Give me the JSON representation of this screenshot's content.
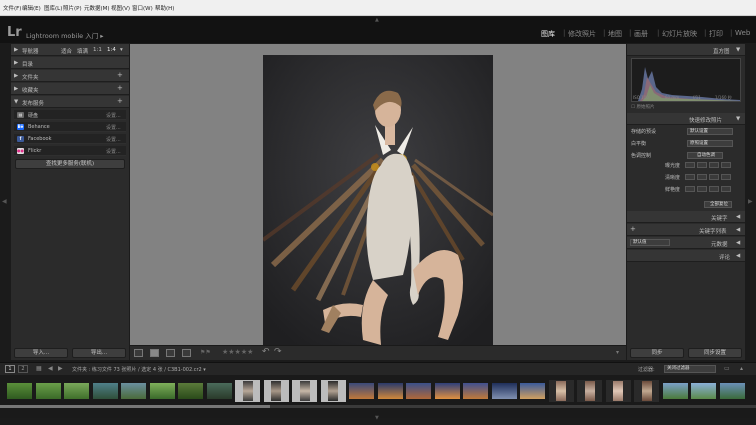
{
  "menubar": {
    "items": [
      "文件(F)",
      "编辑(E)",
      "图库(L)",
      "照片(P)",
      "元数据(M)",
      "视图(V)",
      "窗口(W)",
      "帮助(H)"
    ]
  },
  "identity": {
    "logo": "Lr",
    "app_name": "Lightroom mobile 入门",
    "app_name_arrow": "▸"
  },
  "modules": {
    "items": [
      "图库",
      "修改照片",
      "地图",
      "画册",
      "幻灯片放映",
      "打印",
      "Web"
    ],
    "active": "图库",
    "separator": "|"
  },
  "left_panel": {
    "navigator": {
      "title": "导航器",
      "options": [
        "适合",
        "填满",
        "1:1",
        "1:4"
      ]
    },
    "catalog": {
      "title": "目录"
    },
    "folders": {
      "title": "文件夹",
      "plus": "+"
    },
    "collections": {
      "title": "收藏夹",
      "plus": "+"
    },
    "publish": {
      "title": "发布服务",
      "plus": "+"
    },
    "services": [
      {
        "name": "硬盘",
        "action": "设置...",
        "icon": "hard-drive-icon",
        "color": "#6a6a6a",
        "glyph": "▤"
      },
      {
        "name": "Behance",
        "action": "设置...",
        "icon": "behance-icon",
        "color": "#1769ff",
        "glyph": "Bē"
      },
      {
        "name": "Facebook",
        "action": "设置...",
        "icon": "facebook-icon",
        "color": "#3b5998",
        "glyph": "f"
      },
      {
        "name": "Flickr",
        "action": "设置...",
        "icon": "flickr-icon",
        "color": "#e0e0e0",
        "glyph": "●●"
      }
    ],
    "find_more": "查找更多服务(联机)",
    "import_label": "导入...",
    "export_label": "导出..."
  },
  "right_panel": {
    "histogram": {
      "title": "直方图",
      "readouts": [
        "ISO 100",
        "80 mm",
        "f/11",
        "1/160 秒"
      ],
      "original_label": "原始照片"
    },
    "quick_develop": {
      "title": "快速修改照片",
      "saved_preset_label": "存储的预设",
      "saved_preset_value": "默认设置",
      "wb_label": "白平衡",
      "wb_value": "原照设置",
      "tone_label": "色调控制",
      "auto_tone": "自动色调",
      "exposure_label": "曝光度",
      "clarity_label": "清晰度",
      "vibrance_label": "鲜艳度",
      "reset_all": "全部复位"
    },
    "keywording": {
      "title": "关键字"
    },
    "keyword_list": {
      "title": "关键字列表",
      "plus": "+"
    },
    "metadata": {
      "title": "元数据",
      "preset_value": "默认值"
    },
    "comments": {
      "title": "评论"
    },
    "sync_label": "同步",
    "sync_settings_label": "同步设置"
  },
  "toolbar": {
    "view_modes": [
      "grid-view",
      "loupe-view",
      "compare-view",
      "survey-view"
    ],
    "rating": "★★★★★",
    "rating_value": 0,
    "rotate_left": "↶",
    "rotate_right": "↷"
  },
  "filmstrip": {
    "page_numbers": [
      "1",
      "2"
    ],
    "path": "文件夹 : 练习文件  73 张照片 / 选定 4 张 / C3B1-002.cr2",
    "path_arrow": "▾",
    "filter_label": "过滤器:",
    "filter_value": "关闭过滤器",
    "thumbnails": [
      {
        "kind": "land",
        "c1": "#5a8f3a",
        "c2": "#2f5a20"
      },
      {
        "kind": "land",
        "c1": "#6a9f4a",
        "c2": "#3a6a28"
      },
      {
        "kind": "land",
        "c1": "#7aa85a",
        "c2": "#3f6f2a"
      },
      {
        "kind": "land",
        "c1": "#4f7f8a",
        "c2": "#2f4f3a"
      },
      {
        "kind": "land",
        "c1": "#6a8f9f",
        "c2": "#4a6a3a"
      },
      {
        "kind": "land",
        "c1": "#7fb05a",
        "c2": "#3a6a2a"
      },
      {
        "kind": "land",
        "c1": "#5a7a3a",
        "c2": "#2a4a1a"
      },
      {
        "kind": "land",
        "c1": "#4a6a5a",
        "c2": "#2a3a2a"
      },
      {
        "kind": "port",
        "c1": "#b8a898",
        "c2": "#3a3a3a",
        "selected": true
      },
      {
        "kind": "port",
        "c1": "#a89888",
        "c2": "#2f2f2f",
        "selected": true
      },
      {
        "kind": "port",
        "c1": "#c8b8a8",
        "c2": "#3a3a3a",
        "selected": true
      },
      {
        "kind": "port",
        "c1": "#b0a090",
        "c2": "#2a2a2a",
        "selected": true
      },
      {
        "kind": "land",
        "c1": "#3a4a7a",
        "c2": "#c0783a"
      },
      {
        "kind": "land",
        "c1": "#2a3a6a",
        "c2": "#d0883a"
      },
      {
        "kind": "land",
        "c1": "#3a4f8a",
        "c2": "#b0683a"
      },
      {
        "kind": "land",
        "c1": "#2f3f7a",
        "c2": "#e09040"
      },
      {
        "kind": "land",
        "c1": "#405090",
        "c2": "#c07a3a"
      },
      {
        "kind": "land",
        "c1": "#1f2f5a",
        "c2": "#8090b0"
      },
      {
        "kind": "land",
        "c1": "#3a5a9a",
        "c2": "#d0a060"
      },
      {
        "kind": "port",
        "c1": "#d8c0a8",
        "c2": "#8a6a5a"
      },
      {
        "kind": "port",
        "c1": "#c8b0a0",
        "c2": "#7a5a4a"
      },
      {
        "kind": "port",
        "c1": "#e0c8b8",
        "c2": "#9a7a6a"
      },
      {
        "kind": "port",
        "c1": "#c0a890",
        "c2": "#6a4a3a"
      },
      {
        "kind": "land",
        "c1": "#7aa0c8",
        "c2": "#4a7a3a"
      },
      {
        "kind": "land",
        "c1": "#8ab0d8",
        "c2": "#5a8a4a"
      },
      {
        "kind": "land",
        "c1": "#6a90b8",
        "c2": "#3a6a3a"
      }
    ]
  },
  "colors": {
    "active_module": "#f2f2f2",
    "panel_bg": "#2b2b2b",
    "canvas_bg": "#828282"
  }
}
